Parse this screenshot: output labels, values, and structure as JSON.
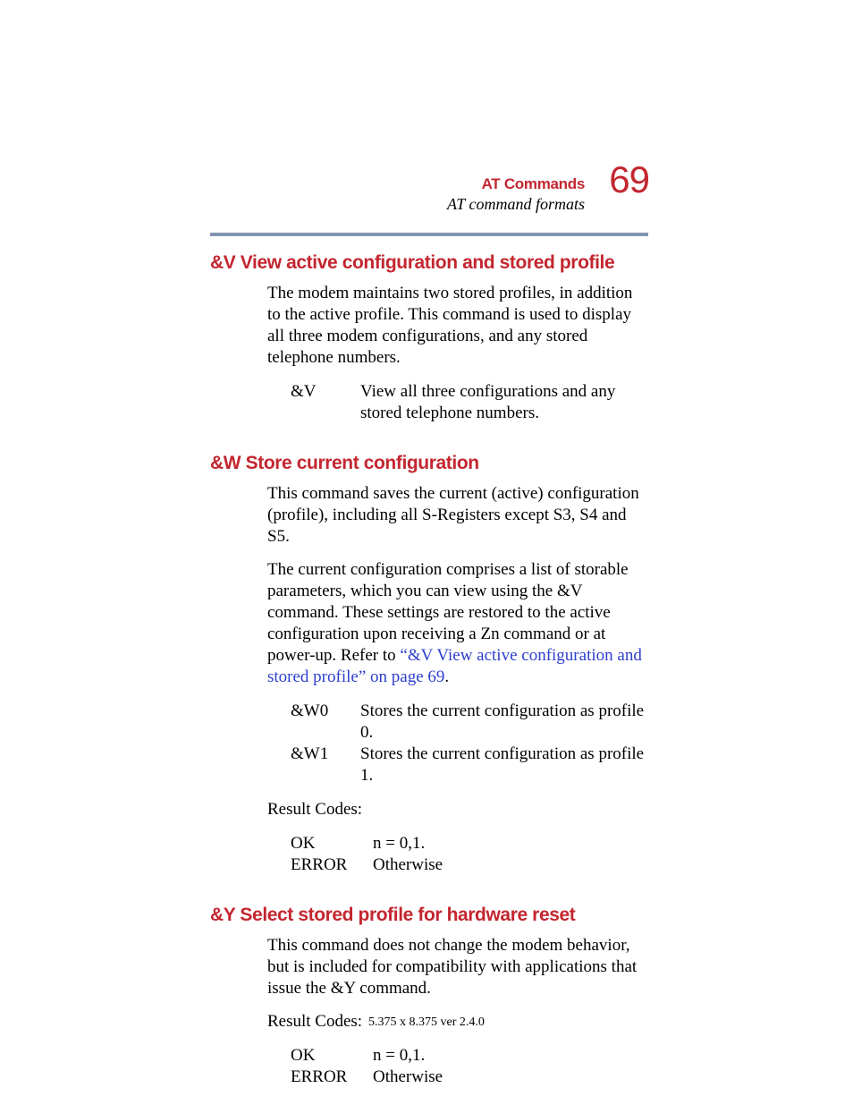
{
  "header": {
    "chapter": "AT Commands",
    "subtitle": "AT command formats",
    "page_number": "69"
  },
  "sections": {
    "v": {
      "heading": "&V View active configuration and stored profile",
      "para1": "The modem maintains two stored profiles, in addition to the active profile. This command is used to display all three modem configurations, and any stored telephone numbers.",
      "opt_key": "&V",
      "opt_desc": "View all three configurations and any stored telephone numbers."
    },
    "w": {
      "heading": "&W Store current configuration",
      "para1": "This command saves the current (active) configuration (profile), including all S-Registers except S3, S4 and S5.",
      "para2_pre": "The current configuration comprises a list of storable parameters, which you can view using the &V command. These settings are restored to the active configuration upon receiving a Zn command or at power-up. Refer to ",
      "para2_link": "“&V View active configuration and stored profile” on page 69",
      "para2_post": ".",
      "opt0_key": "&W0",
      "opt0_desc": "Stores the current configuration as profile 0.",
      "opt1_key": "&W1",
      "opt1_desc": "Stores the current configuration as profile 1.",
      "result_label": "Result Codes:",
      "rc_ok_key": "OK",
      "rc_ok_val": "n = 0,1.",
      "rc_err_key": "ERROR",
      "rc_err_val": "Otherwise"
    },
    "y": {
      "heading": "&Y Select stored profile for hardware reset",
      "para1": "This command does not change the modem behavior, but is included for compatibility with applications that issue the &Y command.",
      "result_label": "Result Codes:",
      "rc_ok_key": "OK",
      "rc_ok_val": "n = 0,1.",
      "rc_err_key": "ERROR",
      "rc_err_val": "Otherwise"
    }
  },
  "footer": "5.375 x 8.375 ver 2.4.0"
}
